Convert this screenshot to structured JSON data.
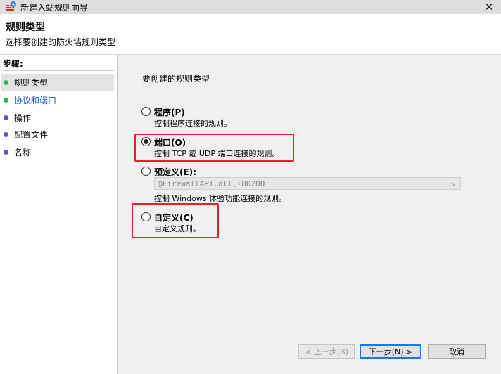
{
  "window": {
    "title": "新建入站规则向导",
    "close_glyph": "✕"
  },
  "header": {
    "title": "规则类型",
    "subtitle": "选择要创建的防火墙规则类型"
  },
  "steps": {
    "heading": "步骤:",
    "items": [
      {
        "label": "规则类型",
        "dot": "green",
        "active": true
      },
      {
        "label": "协议和端口",
        "dot": "green",
        "link": true
      },
      {
        "label": "操作",
        "dot": "blue"
      },
      {
        "label": "配置文件",
        "dot": "blue"
      },
      {
        "label": "名称",
        "dot": "blue"
      }
    ]
  },
  "main": {
    "question": "要创建的规则类型",
    "options": [
      {
        "title": "程序(P)",
        "desc": "控制程序连接的规则。",
        "checked": false
      },
      {
        "title": "端口(O)",
        "desc": "控制 TCP 或 UDP 端口连接的规则。",
        "checked": true
      },
      {
        "title": "预定义(E):",
        "desc": "控制 Windows 体验功能连接的规则。",
        "checked": false
      },
      {
        "title": "自定义(C)",
        "desc": "自定义规则。",
        "checked": false
      }
    ],
    "predefined_select_value": "@FirewallAPI.dll,-80200"
  },
  "buttons": {
    "back": "< 上一步(B)",
    "next": "下一步(N) >",
    "cancel": "取消"
  },
  "colors": {
    "highlight": "#e8202a",
    "step_green": "#2db84a",
    "step_blue": "#5a5ac8",
    "link": "#1e56c0"
  }
}
